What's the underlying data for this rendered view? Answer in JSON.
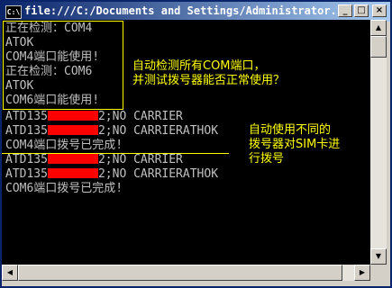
{
  "window": {
    "title": "file:///C:/Documents and Settings/Administrator...",
    "icon_label": "C:\\",
    "buttons": {
      "minimize": "_",
      "maximize": "□",
      "close": "×"
    }
  },
  "console": {
    "lines": [
      "正在检测：COM4",
      "ATOK",
      "COM4端口能使用!",
      "正在检测：COM6",
      "ATOK",
      "COM6端口能使用!",
      "",
      "",
      "ATD135",
      "2;NO CARRIER",
      "ATD135",
      "2;NO CARRIERATHOK",
      "COM4端口拨号已完成!",
      "ATD135",
      "2;NO CARRIER",
      "ATD135",
      "2;NO CARRIERATHOK",
      "COM6端口拨号已完成!"
    ],
    "text_color": "#c0c0c0",
    "background": "#000000"
  },
  "annotations": {
    "note1": {
      "line1": "自动检测所有COM端口，",
      "line2": "并测试拨号器能否正常使用？"
    },
    "note2": {
      "line1": "自动使用不同的",
      "line2": "拨号器对SIM卡进",
      "line3": "行拨号"
    },
    "color": "#ffff00",
    "redaction_color": "#ff0000"
  }
}
